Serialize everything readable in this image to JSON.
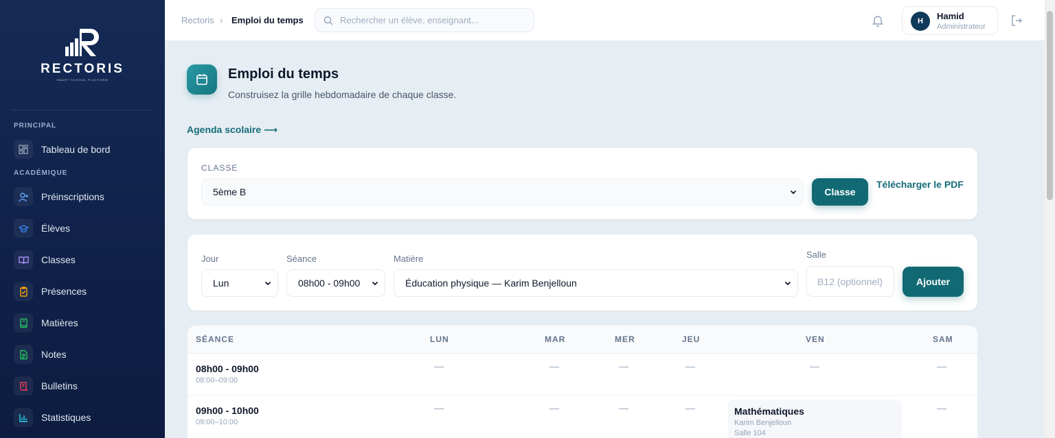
{
  "brand": {
    "name": "RECTORIS",
    "tagline": "SMART SCHOOL PLATFORM"
  },
  "sidebar": {
    "sections": [
      {
        "label": "PRINCIPAL"
      },
      {
        "label": "ACADÉMIQUE"
      }
    ],
    "items": [
      {
        "label": "Tableau de bord",
        "icon": "dashboard-icon",
        "color": "#94a3b8"
      },
      {
        "label": "Préinscriptions",
        "icon": "user-plus-icon",
        "color": "#60a5fa"
      },
      {
        "label": "Élèves",
        "icon": "graduation-cap-icon",
        "color": "#3b82f6"
      },
      {
        "label": "Classes",
        "icon": "book-open-icon",
        "color": "#a78bfa"
      },
      {
        "label": "Présences",
        "icon": "clipboard-check-icon",
        "color": "#f59e0b"
      },
      {
        "label": "Matières",
        "icon": "book-icon",
        "color": "#22c55e"
      },
      {
        "label": "Notes",
        "icon": "file-text-icon",
        "color": "#22c55e"
      },
      {
        "label": "Bulletins",
        "icon": "scroll-icon",
        "color": "#f43f5e"
      },
      {
        "label": "Statistiques",
        "icon": "bar-chart-icon",
        "color": "#22d3ee"
      }
    ]
  },
  "topbar": {
    "breadcrumb": {
      "root": "Rectoris",
      "separator": "›",
      "current": "Emploi du temps"
    },
    "search": {
      "placeholder": "Rechercher un élève, enseignant..."
    },
    "user": {
      "initial": "H",
      "name": "Hamid",
      "role": "Administrateur"
    }
  },
  "header": {
    "title": "Emploi du temps",
    "subtitle": "Construisez la grille hebdomadaire de chaque classe.",
    "agenda_link": "Agenda scolaire ⟶"
  },
  "class_card": {
    "label": "CLASSE",
    "selected": "5ème B",
    "button": "Classe",
    "pdf_link": "Télécharger le PDF"
  },
  "form": {
    "day": {
      "label": "Jour",
      "value": "Lun"
    },
    "slot": {
      "label": "Séance",
      "value": "08h00 - 09h00"
    },
    "subject": {
      "label": "Matière",
      "value": "Éducation physique — Karim Benjelloun"
    },
    "room": {
      "label": "Salle",
      "placeholder": "B12 (optionnel)"
    },
    "submit": "Ajouter"
  },
  "table": {
    "headers": [
      "SÉANCE",
      "LUN",
      "MAR",
      "MER",
      "JEU",
      "VEN",
      "SAM"
    ],
    "empty": "—",
    "rows": [
      {
        "slot": "08h00 - 09h00",
        "time": "08:00–09:00"
      },
      {
        "slot": "09h00 - 10h00",
        "time": "09:00–10:00"
      }
    ],
    "lesson": {
      "subject": "Mathématiques",
      "teacher": "Karim Benjelloun",
      "room": "Salle 104"
    }
  },
  "colors": {
    "accent": "#116a73",
    "sidebar": "#142a55",
    "link": "#146c78"
  }
}
